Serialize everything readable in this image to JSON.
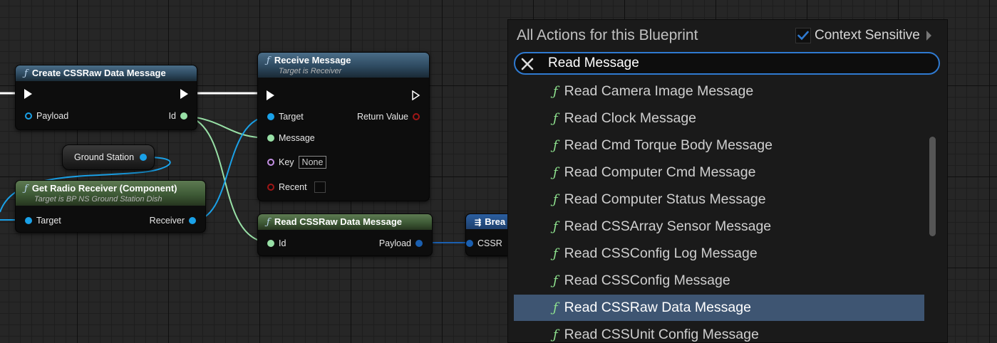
{
  "graph": {
    "create_node": {
      "title": "Create CSSRaw Data Message",
      "pin_payload": "Payload",
      "pin_id": "Id"
    },
    "ground_station_node": {
      "label": "Ground Station"
    },
    "radio_node": {
      "title": "Get Radio Receiver (Component)",
      "subtitle": "Target is BP NS Ground Station Dish",
      "pin_target": "Target",
      "pin_receiver": "Receiver"
    },
    "receive_node": {
      "title": "Receive Message",
      "subtitle": "Target is Receiver",
      "pin_target": "Target",
      "pin_return": "Return Value",
      "pin_message": "Message",
      "pin_key": "Key",
      "key_value": "None",
      "pin_recent": "Recent"
    },
    "read_node": {
      "title": "Read CSSRaw Data Message",
      "pin_id": "Id",
      "pin_payload": "Payload"
    },
    "break_node": {
      "title": "Brea",
      "pin_css": "CSSR"
    }
  },
  "menu": {
    "title": "All Actions for this Blueprint",
    "context_label": "Context Sensitive",
    "context_checked": true,
    "search_value": "Read Message",
    "items": [
      {
        "label": "Read Camera Image Message"
      },
      {
        "label": "Read Clock Message"
      },
      {
        "label": "Read Cmd Torque Body Message"
      },
      {
        "label": "Read Computer Cmd Message"
      },
      {
        "label": "Read Computer Status Message"
      },
      {
        "label": "Read CSSArray Sensor Message"
      },
      {
        "label": "Read CSSConfig Log Message"
      },
      {
        "label": "Read CSSConfig Message"
      },
      {
        "label": "Read CSSRaw Data Message",
        "selected": true
      },
      {
        "label": "Read CSSUnit Config Message"
      }
    ]
  },
  "colors": {
    "accent": "#2f7ad1",
    "selected_row": "#3e5572",
    "function_icon": "#8fe38f",
    "object_pin": "#1aa1e8",
    "int_pin": "#98e0a6"
  }
}
